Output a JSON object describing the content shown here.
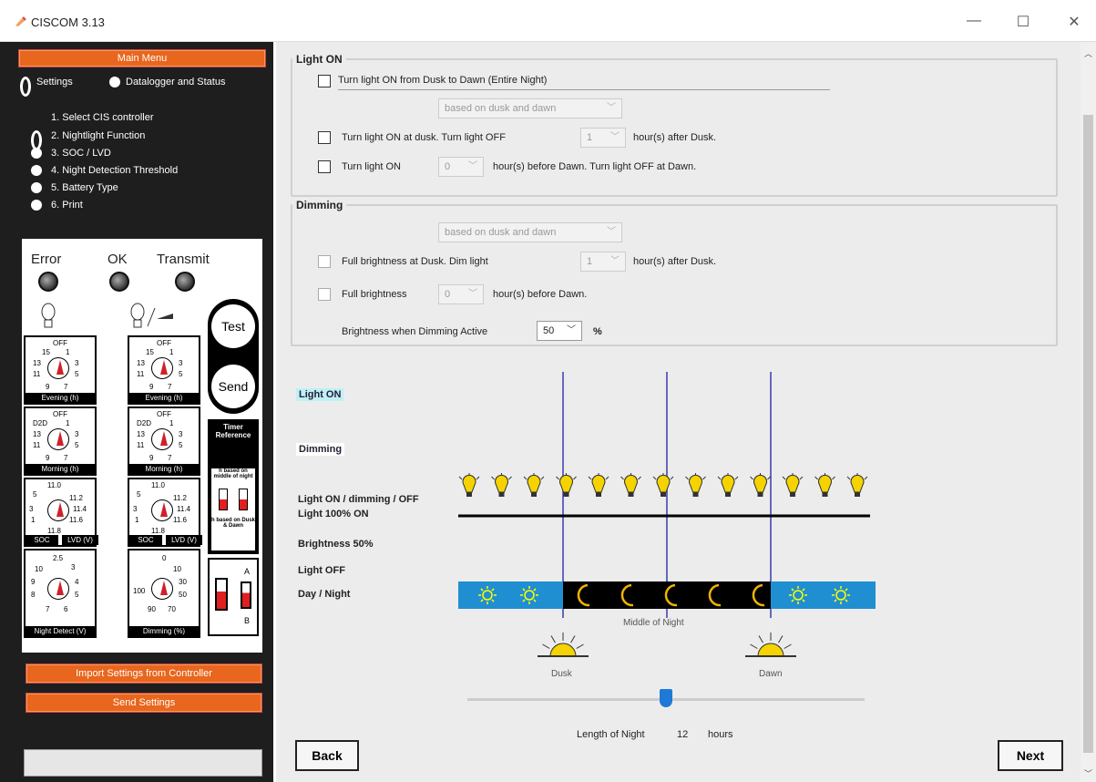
{
  "window": {
    "title": "CISCOM 3.13",
    "min": "—",
    "max": "☐",
    "close": "✕"
  },
  "left": {
    "main_menu": "Main Menu",
    "radio_settings": "Settings",
    "radio_datalogger": "Datalogger and Status",
    "steps": [
      "1. Select CIS controller",
      "2. Nightlight Function",
      "3. SOC / LVD",
      "4. Night Detection Threshold",
      "5. Battery Type",
      "6. Print"
    ],
    "import_btn": "Import Settings from Controller",
    "send_btn": "Send Settings",
    "status": ""
  },
  "device": {
    "leds": [
      "Error",
      "OK",
      "Transmit"
    ],
    "test": "Test",
    "send": "Send",
    "timer_ref": "Timer Reference",
    "h_mid": "h based on middle of night",
    "h_dusk": "h based on Dusk & Dawn",
    "knob_labels": [
      "Evening (h)",
      "Evening (h)",
      "Morning (h)",
      "Morning (h)",
      "SOC",
      "LVD (V)",
      "SOC",
      "LVD (V)",
      "Night Detect (V)",
      "Dimming (%)"
    ],
    "sw_a": "A",
    "sw_b": "B"
  },
  "light_on": {
    "legend": "Light ON",
    "opt1": "Turn light ON from Dusk to Dawn (Entire Night)",
    "basis": "based on dusk and dawn",
    "opt2_a": "Turn light ON at dusk. Turn light OFF",
    "opt2_val": "1",
    "opt2_b": "hour(s) after Dusk.",
    "opt3_a": "Turn light ON",
    "opt3_val": "0",
    "opt3_b": "hour(s) before Dawn. Turn light OFF at Dawn."
  },
  "dimming": {
    "legend": "Dimming",
    "basis": "based on dusk and dawn",
    "opt1_a": "Full brightness at Dusk. Dim light",
    "opt1_val": "1",
    "opt1_b": "hour(s) after Dusk.",
    "opt2_a": "Full brightness",
    "opt2_val": "0",
    "opt2_b": "hour(s) before Dawn.",
    "brightness_label": "Brightness when Dimming Active",
    "brightness_val": "50",
    "pct": "%"
  },
  "diagram": {
    "light_on_tag": "Light ON",
    "dimming_tag": "Dimming",
    "row_labels": [
      "Light ON / dimming / OFF",
      "Light 100% ON",
      "Brightness 50%",
      "Light OFF",
      "Day / Night"
    ],
    "middle": "Middle of Night",
    "dusk": "Dusk",
    "dawn": "Dawn",
    "length_label": "Length of Night",
    "length_val": "12",
    "length_unit": "hours",
    "length_value": 12
  },
  "buttons": {
    "back": "Back",
    "next": "Next"
  },
  "colors": {
    "orange": "#e8661d",
    "day_blue": "#1f8fd1",
    "night": "#000000",
    "bulb": "#f5d300",
    "line_blue": "#3b3bb0"
  }
}
